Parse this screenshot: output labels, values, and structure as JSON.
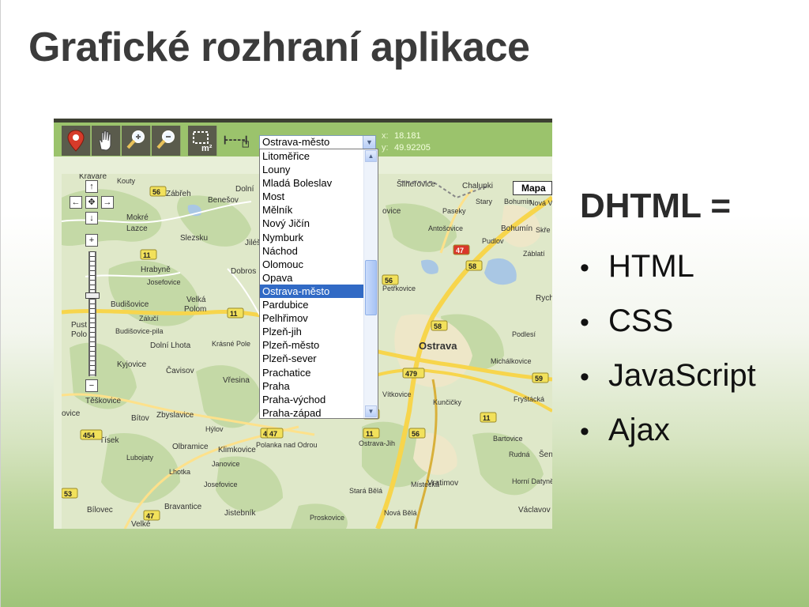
{
  "slide": {
    "title": "Grafické rozhraní aplikace",
    "heading": "DHTML =",
    "bullets": [
      "HTML",
      "CSS",
      "JavaScript",
      "Ajax"
    ]
  },
  "toolbar": {
    "tools": [
      "map-pin-icon",
      "hand-icon",
      "zoom-in-icon",
      "zoom-out-icon",
      "select-area-icon",
      "measure-icon"
    ],
    "select_area_unit": "m²",
    "selected_city": "Ostrava-město",
    "coords": {
      "x_label": "x:",
      "x_value": "18.181",
      "y_label": "y:",
      "y_value": "49.92205"
    }
  },
  "dropdown": {
    "options": [
      "Litoměřice",
      "Louny",
      "Mladá Boleslav",
      "Most",
      "Mělník",
      "Nový Jičín",
      "Nymburk",
      "Náchod",
      "Olomouc",
      "Opava",
      "Ostrava-město",
      "Pardubice",
      "Pelhřimov",
      "Plzeň-jih",
      "Plzeň-město",
      "Plzeň-sever",
      "Prachatice",
      "Praha",
      "Praha-východ",
      "Praha-západ"
    ],
    "selected_index": 10
  },
  "map": {
    "type_button": "Mapa",
    "place_labels": [
      {
        "text": "Kravaře"
      },
      {
        "text": "Kouty"
      },
      {
        "text": "Zábřeh"
      },
      {
        "text": "Dolní"
      },
      {
        "text": "Benešov"
      },
      {
        "text": "Mokré"
      },
      {
        "text": "Lazce"
      },
      {
        "text": "Slezsku"
      },
      {
        "text": "Jiléšo"
      },
      {
        "text": "Hrabyně"
      },
      {
        "text": "Josefovice"
      },
      {
        "text": "Dobros"
      },
      {
        "text": "Budišovice"
      },
      {
        "text": "Velká"
      },
      {
        "text": "Polom"
      },
      {
        "text": "Zálučí"
      },
      {
        "text": "Budišovice-pila"
      },
      {
        "text": "Dolní Lhota"
      },
      {
        "text": "Krásné Pole"
      },
      {
        "text": "Kyjovice"
      },
      {
        "text": "Čavisov"
      },
      {
        "text": "Vřesina"
      },
      {
        "text": "Těškovice"
      },
      {
        "text": "Bítov"
      },
      {
        "text": "Zbyslavice"
      },
      {
        "text": "Hýlov"
      },
      {
        "text": "Tísek"
      },
      {
        "text": "Olbramice"
      },
      {
        "text": "Klimkovice"
      },
      {
        "text": "Polanka nad Odrou"
      },
      {
        "text": "Lubojaty"
      },
      {
        "text": "Janovice"
      },
      {
        "text": "Lhotka"
      },
      {
        "text": "Josefovice"
      },
      {
        "text": "Bílovec"
      },
      {
        "text": "Bravantice"
      },
      {
        "text": "Jistebník"
      },
      {
        "text": "Velké"
      },
      {
        "text": "Proskovice"
      },
      {
        "text": "Nová Bělá"
      },
      {
        "text": "Stará Bělá"
      },
      {
        "text": "Ostrava-Jih"
      },
      {
        "text": "Vratimov"
      },
      {
        "text": "Ostrava"
      },
      {
        "text": "Vítkovice"
      },
      {
        "text": "Kunčičky"
      },
      {
        "text": "Šilheřovice"
      },
      {
        "text": "Chalupki"
      },
      {
        "text": "Stary"
      },
      {
        "text": "Bohumin"
      },
      {
        "text": "Paseky"
      },
      {
        "text": "Antošovice"
      },
      {
        "text": "Bohumín"
      },
      {
        "text": "Pudlov"
      },
      {
        "text": "Záblatí"
      },
      {
        "text": "Petřkovice"
      },
      {
        "text": "Rychv"
      },
      {
        "text": "Michálkovice"
      },
      {
        "text": "Podlesí"
      },
      {
        "text": "Bartovice"
      },
      {
        "text": "Šeno"
      },
      {
        "text": "Horní Datyně"
      },
      {
        "text": "Václavov"
      },
      {
        "text": "Fryštácká"
      },
      {
        "text": "Rudná"
      },
      {
        "text": "Místecká"
      },
      {
        "text": "Nová Ves"
      },
      {
        "text": "Skře"
      },
      {
        "text": "ovice"
      },
      {
        "text": "Pust"
      },
      {
        "text": "Polo"
      },
      {
        "text": "ovice"
      }
    ],
    "road_numbers": [
      "56",
      "11",
      "11",
      "56",
      "58",
      "58",
      "47",
      "47",
      "479",
      "59",
      "11",
      "58",
      "11",
      "56",
      "454",
      "47",
      "47",
      "53"
    ]
  }
}
